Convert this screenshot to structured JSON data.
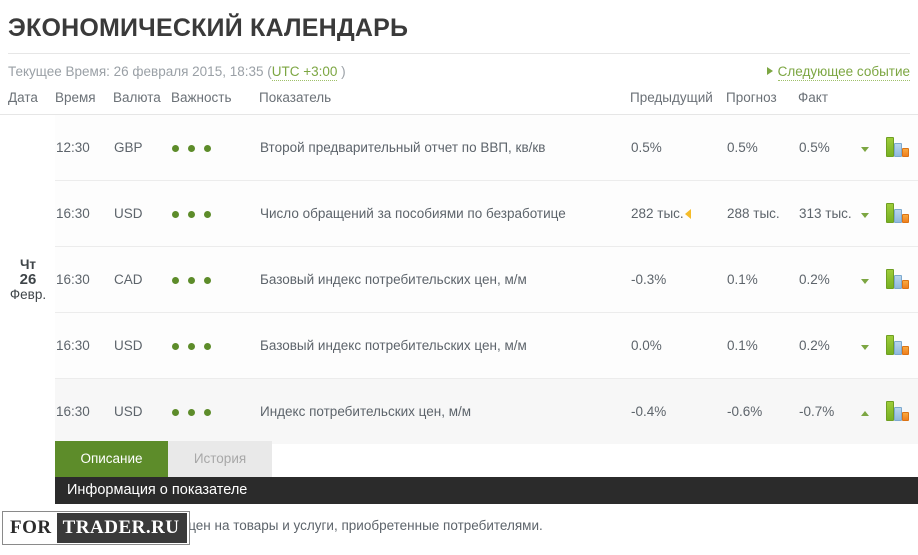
{
  "header": {
    "title": "ЭКОНОМИЧЕСКИЙ КАЛЕНДАРЬ",
    "current_time_label": "Текущее Время:",
    "current_time_value": "26 февраля 2015, 18:35",
    "utc_open_paren": "(",
    "utc_link": "UTC +3:00",
    "utc_close_paren": ")",
    "next_event_label": "Следующее событие"
  },
  "table": {
    "columns": {
      "date": "Дата",
      "time": "Время",
      "currency": "Валюта",
      "importance": "Важность",
      "indicator": "Показатель",
      "previous": "Предыдущий",
      "forecast": "Прогноз",
      "fact": "Факт"
    },
    "date_group": {
      "dow": "Чт",
      "day": "26",
      "month": "Февр."
    },
    "rows": [
      {
        "time": "12:30",
        "currency": "GBP",
        "importance": 3,
        "indicator": "Второй предварительный отчет по ВВП, кв/кв",
        "previous": "0.5%",
        "previous_revised": false,
        "forecast": "0.5%",
        "fact": "0.5%",
        "fact_color": "neutral",
        "chevron": "down",
        "selected": false
      },
      {
        "time": "16:30",
        "currency": "USD",
        "importance": 3,
        "indicator": "Число обращений за пособиями по безработице",
        "previous": "282 тыс.",
        "previous_revised": true,
        "forecast": "288 тыс.",
        "fact": "313 тыс.",
        "fact_color": "red",
        "chevron": "down",
        "selected": false
      },
      {
        "time": "16:30",
        "currency": "CAD",
        "importance": 3,
        "indicator": "Базовый индекс потребительских цен, м/м",
        "previous": "-0.3%",
        "previous_revised": false,
        "forecast": "0.1%",
        "fact": "0.2%",
        "fact_color": "green",
        "chevron": "down",
        "selected": false
      },
      {
        "time": "16:30",
        "currency": "USD",
        "importance": 3,
        "indicator": "Базовый индекс потребительских цен, м/м",
        "previous": "0.0%",
        "previous_revised": false,
        "forecast": "0.1%",
        "fact": "0.2%",
        "fact_color": "green",
        "chevron": "down",
        "selected": false
      },
      {
        "time": "16:30",
        "currency": "USD",
        "importance": 3,
        "indicator": "Индекс потребительских цен, м/м",
        "previous": "-0.4%",
        "previous_revised": false,
        "forecast": "-0.6%",
        "fact": "-0.7%",
        "fact_color": "red",
        "chevron": "up",
        "selected": true
      }
    ]
  },
  "detail": {
    "tab_description": "Описание",
    "tab_history": "История",
    "info_bar_title": "Информация о показателе",
    "info_text": "Изменение уровня цен на товары и услуги, приобретенные потребителями."
  },
  "watermark": {
    "part1": "FOR",
    "part2": "TRADER.RU"
  },
  "colors": {
    "accent_green": "#5d8c2a",
    "link_green": "#7ca642",
    "negative_red": "#d9534f",
    "positive_green": "#6aa84f",
    "revision_yellow": "#f5bc2a",
    "dark_bar": "#2b2b2b"
  }
}
